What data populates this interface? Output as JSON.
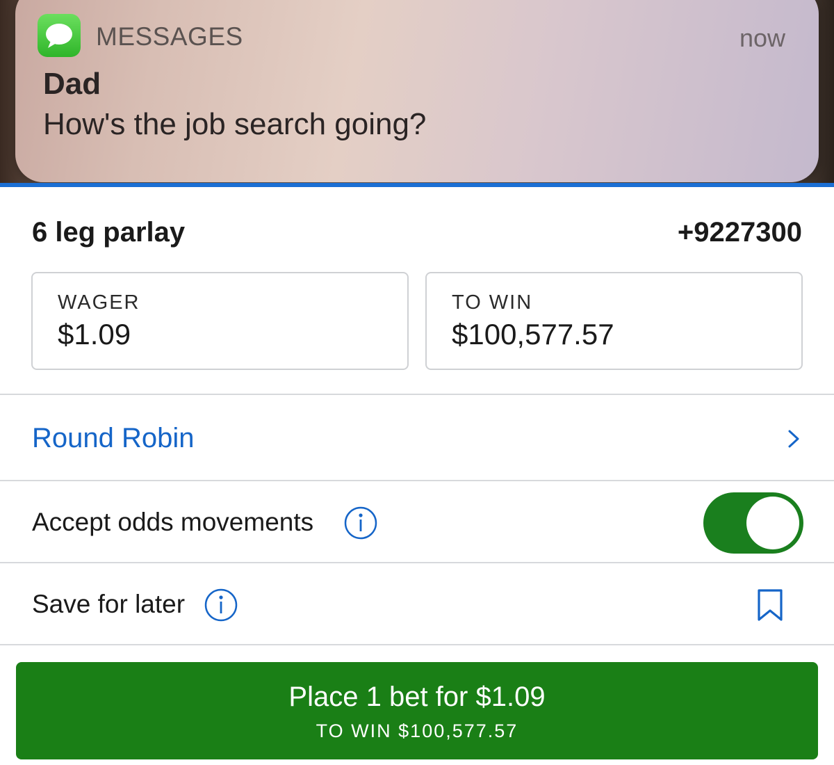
{
  "notification": {
    "app_name": "MESSAGES",
    "time": "now",
    "sender": "Dad",
    "message": "How's the job search going?"
  },
  "bet": {
    "title": "6 leg parlay",
    "odds": "+9227300",
    "wager_label": "WAGER",
    "wager_value": "$1.09",
    "to_win_label": "TO WIN",
    "to_win_value": "$100,577.57"
  },
  "options": {
    "round_robin": "Round Robin",
    "accept_odds": "Accept odds movements",
    "accept_odds_enabled": true,
    "save_for_later": "Save for later"
  },
  "place_button": {
    "label": "Place 1 bet for $1.09",
    "sublabel": "TO WIN $100,577.57"
  },
  "colors": {
    "link_blue": "#1565c8",
    "accent_green": "#1a7f16",
    "rule_blue": "#1b6fd4"
  },
  "icons": [
    "messages-app-icon",
    "chevron-right-icon",
    "info-icon",
    "bookmark-icon"
  ]
}
